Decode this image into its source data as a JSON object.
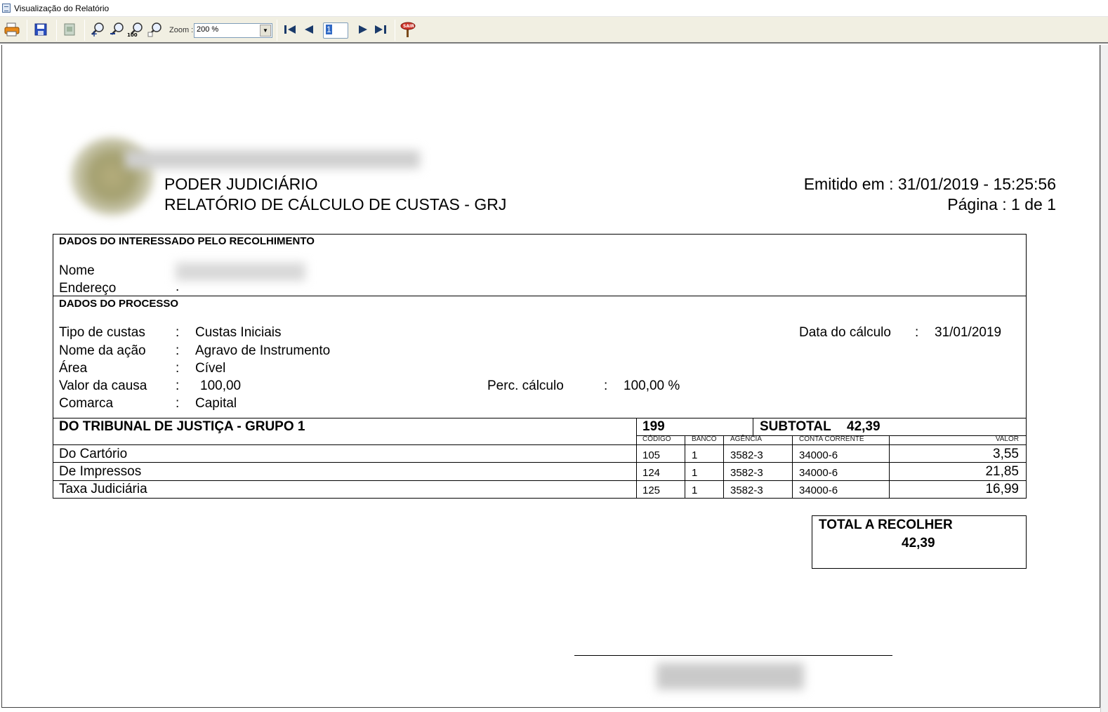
{
  "window": {
    "title": "Visualização do Relatório"
  },
  "toolbar": {
    "zoom_label": "Zoom :",
    "zoom_value": "200 %",
    "page_value": "1",
    "exit_label": "SAIR",
    "buttons": [
      "print-icon",
      "save-icon",
      "page-setup-icon",
      "zoom-in-icon",
      "zoom-out-icon",
      "zoom-100-icon",
      "zoom-fit-icon",
      "first-page-icon",
      "prev-page-icon",
      "next-page-icon",
      "last-page-icon",
      "exit-icon"
    ]
  },
  "report": {
    "header": {
      "org": "PODER JUDICIÁRIO",
      "title": "RELATÓRIO DE CÁLCULO DE CUSTAS - GRJ",
      "issued": "Emitido em : 31/01/2019 - 15:25:56",
      "page": "Página : 1 de 1"
    },
    "interessado": {
      "section_title": "DADOS DO INTERESSADO PELO RECOLHIMENTO",
      "nome_label": "Nome",
      "endereco_label": "Endereço",
      "endereco_value": "."
    },
    "processo": {
      "section_title": "DADOS DO PROCESSO",
      "sep": ":",
      "tipo_label": "Tipo de custas",
      "tipo_value": "Custas Iniciais",
      "acao_label": "Nome da ação",
      "acao_value": "Agravo de Instrumento",
      "area_label": "Área",
      "area_value": "Cível",
      "valor_label": "Valor da causa",
      "valor_value": "100,00",
      "comarca_label": "Comarca",
      "comarca_value": "Capital",
      "data_label": "Data do cálculo",
      "data_value": "31/01/2019",
      "perc_label": "Perc. cálculo",
      "perc_value": "100,00 %"
    },
    "grupo": {
      "title": "DO TRIBUNAL DE JUSTIÇA - GRUPO 1",
      "code": "199",
      "subtotal_label": "SUBTOTAL",
      "subtotal_value": "42,39",
      "columns": {
        "codigo": "CÓDIGO",
        "banco": "BANCO",
        "agencia": "AGÊNCIA",
        "conta": "CONTA CORRENTE",
        "valor": "VALOR"
      },
      "rows": [
        {
          "desc": "Do Cartório",
          "codigo": "105",
          "banco": "1",
          "agencia": "3582-3",
          "conta": "34000-6",
          "valor": "3,55"
        },
        {
          "desc": "De Impressos",
          "codigo": "124",
          "banco": "1",
          "agencia": "3582-3",
          "conta": "34000-6",
          "valor": "21,85"
        },
        {
          "desc": "Taxa Judiciária",
          "codigo": "125",
          "banco": "1",
          "agencia": "3582-3",
          "conta": "34000-6",
          "valor": "16,99"
        }
      ]
    },
    "total": {
      "label": "TOTAL A RECOLHER",
      "value": "42,39"
    }
  }
}
